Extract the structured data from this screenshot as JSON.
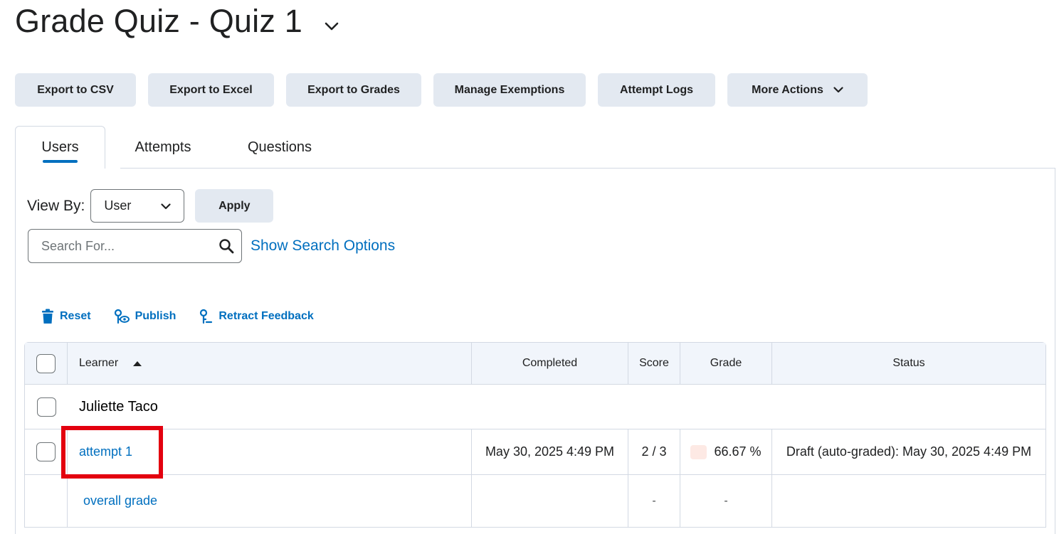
{
  "page": {
    "title": "Grade Quiz - Quiz 1"
  },
  "toolbar": {
    "buttons": [
      {
        "label": "Export to CSV"
      },
      {
        "label": "Export to Excel"
      },
      {
        "label": "Export to Grades"
      },
      {
        "label": "Manage Exemptions"
      },
      {
        "label": "Attempt Logs"
      },
      {
        "label": "More Actions"
      }
    ]
  },
  "tabs": [
    {
      "label": "Users",
      "active": true
    },
    {
      "label": "Attempts",
      "active": false
    },
    {
      "label": "Questions",
      "active": false
    }
  ],
  "view_by": {
    "label": "View By:",
    "selected": "User",
    "apply_label": "Apply"
  },
  "search": {
    "placeholder": "Search For...",
    "value": "",
    "show_options_label": "Show Search Options"
  },
  "actions": [
    {
      "label": "Reset",
      "icon": "trash-icon"
    },
    {
      "label": "Publish",
      "icon": "publish-icon"
    },
    {
      "label": "Retract Feedback",
      "icon": "retract-icon"
    }
  ],
  "table": {
    "headers": {
      "learner": "Learner",
      "completed": "Completed",
      "score": "Score",
      "grade": "Grade",
      "status": "Status"
    },
    "user": {
      "name": "Juliette Taco"
    },
    "attempt": {
      "label": "attempt 1",
      "completed": "May 30, 2025 4:49 PM",
      "score": "2 / 3",
      "grade": "66.67 %",
      "status": "Draft (auto-graded): May 30, 2025 4:49 PM"
    },
    "overall": {
      "label": "overall grade",
      "score": "-",
      "grade": "-"
    }
  },
  "colors": {
    "link": "#006fbf",
    "button_bg": "#e3e9f1",
    "highlight": "#e3000f",
    "grade_swatch": "#fde9e4"
  }
}
